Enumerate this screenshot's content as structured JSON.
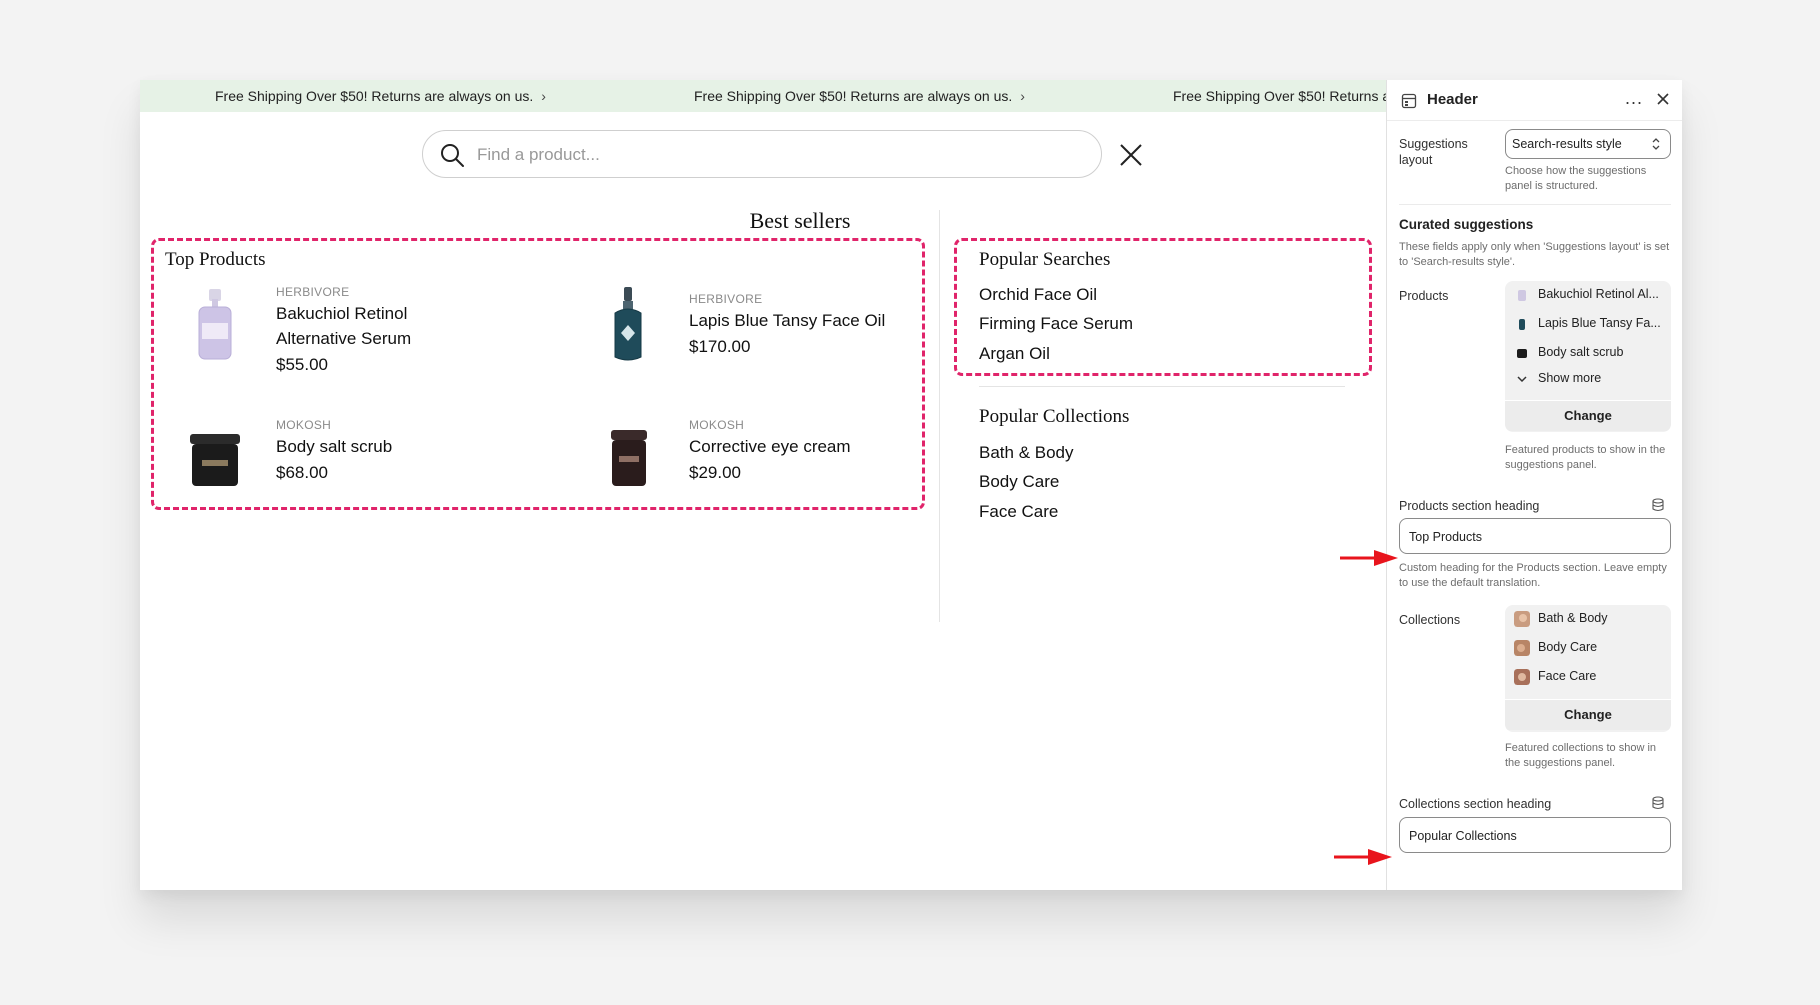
{
  "announcement": {
    "text": "Free Shipping Over $50! Returns are always on us."
  },
  "search": {
    "placeholder": "Find a product..."
  },
  "preview": {
    "best_sellers_title": "Best sellers",
    "products_heading": "Top Products",
    "products": [
      {
        "vendor": "HERBIVORE",
        "name": "Bakuchiol Retinol Alternative Serum",
        "price": "$55.00"
      },
      {
        "vendor": "HERBIVORE",
        "name": "Lapis Blue Tansy Face Oil",
        "price": "$170.00"
      },
      {
        "vendor": "MOKOSH",
        "name": "Body salt scrub",
        "price": "$68.00"
      },
      {
        "vendor": "MOKOSH",
        "name": "Corrective eye cream",
        "price": "$29.00"
      }
    ],
    "popular_searches_heading": "Popular Searches",
    "popular_searches": [
      "Orchid Face Oil",
      "Firming Face Serum",
      "Argan Oil"
    ],
    "popular_collections_heading": "Popular Collections",
    "popular_collections": [
      "Bath & Body",
      "Body Care",
      "Face Care"
    ]
  },
  "panel": {
    "title": "Header",
    "more_label": "...",
    "suggestions_layout": {
      "label": "Suggestions layout",
      "value": "Search-results style",
      "help": "Choose how the suggestions panel is structured."
    },
    "curated": {
      "heading": "Curated suggestions",
      "help": "These fields apply only when 'Suggestions layout' is set to 'Search-results style'."
    },
    "products": {
      "label": "Products",
      "items": [
        "Bakuchiol Retinol Al...",
        "Lapis Blue Tansy Fa...",
        "Body salt scrub"
      ],
      "show_more": "Show more",
      "change": "Change",
      "help": "Featured products to show in the suggestions panel."
    },
    "products_heading_field": {
      "label": "Products section heading",
      "value": "Top Products",
      "help": "Custom heading for the Products section. Leave empty to use the default translation."
    },
    "collections": {
      "label": "Collections",
      "items": [
        "Bath & Body",
        "Body Care",
        "Face Care"
      ],
      "change": "Change",
      "help": "Featured collections to show in the suggestions panel."
    },
    "collections_heading_field": {
      "label": "Collections section heading",
      "value": "Popular Collections"
    }
  },
  "colors": {
    "highlight_dash": "#e0246a",
    "announcement_bg": "#e6f2e6",
    "arrow": "#e8141c"
  },
  "icons": [
    "search-icon",
    "close-icon",
    "header-section-icon",
    "more-icon",
    "panel-close-icon",
    "select-arrows-icon",
    "chevron-down-icon",
    "dynamic-source-icon",
    "red-arrow-icon"
  ]
}
